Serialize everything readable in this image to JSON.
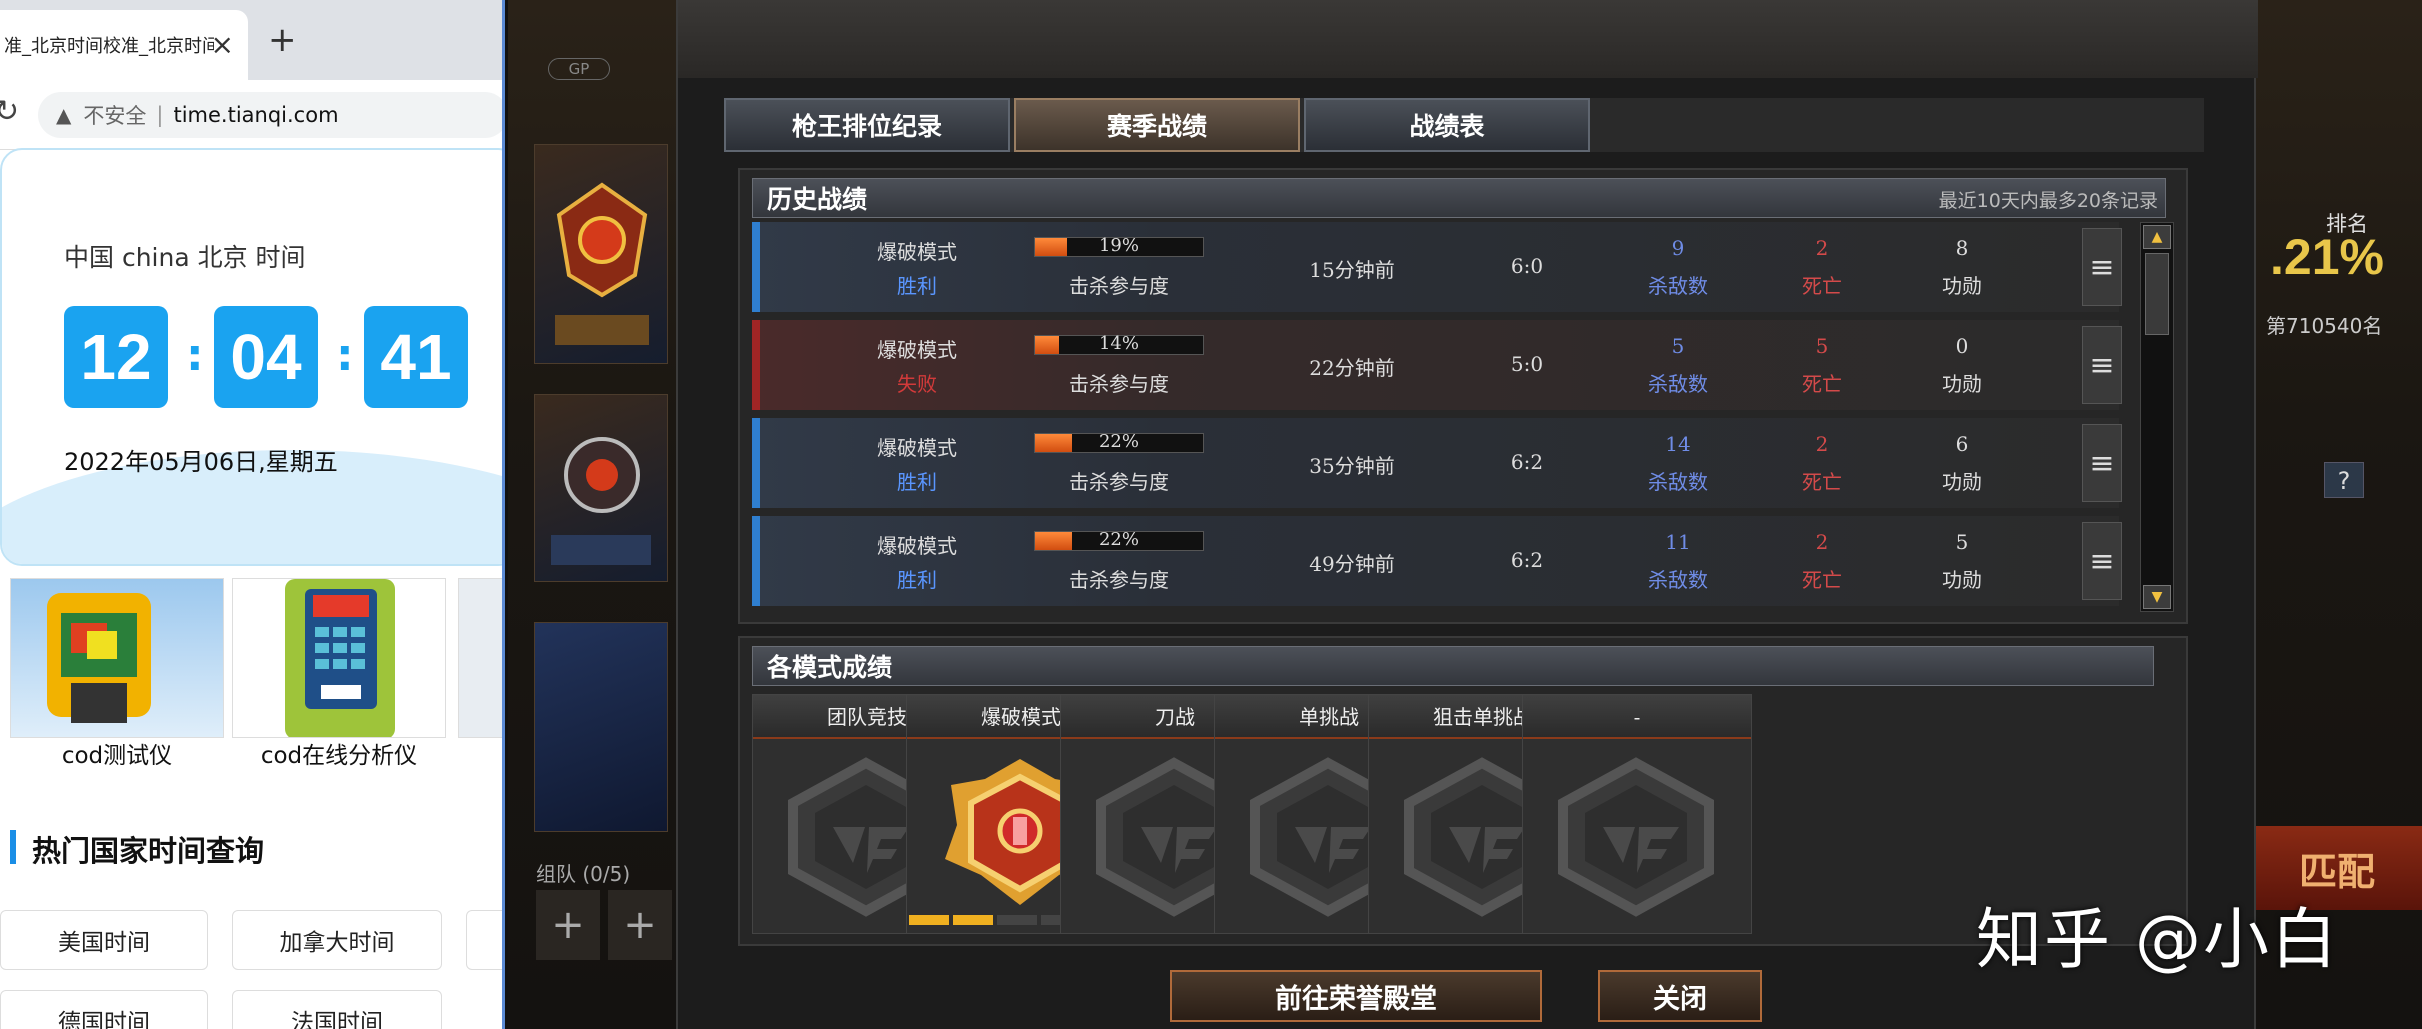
{
  "browser": {
    "tab_title": "准_北京时间校准_北京时间",
    "new_tab": "+",
    "close": "×",
    "security_label": "不安全",
    "separator": "|",
    "url": "time.tianqi.com",
    "clock": {
      "title": "中国 china 北京 时间",
      "hours": "12",
      "minutes": "04",
      "seconds": "41",
      "colon": ":",
      "date": "2022年05月06日,星期五"
    },
    "products": [
      {
        "label": "cod测试仪"
      },
      {
        "label": "cod在线分析仪"
      }
    ],
    "hot_title": "热门国家时间查询",
    "countries": [
      "美国时间",
      "加拿大时间",
      "德国时间",
      "法国时间"
    ]
  },
  "game": {
    "gp_label": "GP",
    "team_label": "组队 (0/5)",
    "plus": "+",
    "rank_label": "排名",
    "rank_pct": ".21%",
    "rank_number": "第710540名",
    "help": "?",
    "match_button": "匹配",
    "watermark": "知乎 @小白"
  },
  "dialog": {
    "tabs": [
      "枪王排位纪录",
      "赛季战绩",
      "战绩表"
    ],
    "active_tab": 1,
    "history": {
      "title": "历史战绩",
      "note": "最近10天内最多20条记录",
      "rows": [
        {
          "mode": "爆破模式",
          "result": "胜利",
          "outcome": "win",
          "pct": 19,
          "pct_text": "19%",
          "part_label": "击杀参与度",
          "ago": "15分钟前",
          "score": "6:0",
          "kills": "9",
          "kills_label": "杀敌数",
          "deaths": "2",
          "deaths_label": "死亡",
          "merit": "8",
          "merit_label": "功勋"
        },
        {
          "mode": "爆破模式",
          "result": "失败",
          "outcome": "loss",
          "pct": 14,
          "pct_text": "14%",
          "part_label": "击杀参与度",
          "ago": "22分钟前",
          "score": "5:0",
          "kills": "5",
          "kills_label": "杀敌数",
          "deaths": "5",
          "deaths_label": "死亡",
          "merit": "0",
          "merit_label": "功勋"
        },
        {
          "mode": "爆破模式",
          "result": "胜利",
          "outcome": "win",
          "pct": 22,
          "pct_text": "22%",
          "part_label": "击杀参与度",
          "ago": "35分钟前",
          "score": "6:2",
          "kills": "14",
          "kills_label": "杀敌数",
          "deaths": "2",
          "deaths_label": "死亡",
          "merit": "6",
          "merit_label": "功勋"
        },
        {
          "mode": "爆破模式",
          "result": "胜利",
          "outcome": "win",
          "pct": 22,
          "pct_text": "22%",
          "part_label": "击杀参与度",
          "ago": "49分钟前",
          "score": "6:2",
          "kills": "11",
          "kills_label": "杀敌数",
          "deaths": "2",
          "deaths_label": "死亡",
          "merit": "5",
          "merit_label": "功勋"
        }
      ]
    },
    "modes": {
      "title": "各模式成绩",
      "cards": [
        {
          "name": "团队竞技",
          "ranked": false
        },
        {
          "name": "爆破模式",
          "ranked": true,
          "progress_segments": 5,
          "progress_filled": 2
        },
        {
          "name": "刀战",
          "ranked": false
        },
        {
          "name": "单挑战",
          "ranked": false
        },
        {
          "name": "狙击单挑战",
          "ranked": false
        },
        {
          "name": "-",
          "ranked": false
        }
      ]
    },
    "buttons": {
      "hall": "前往荣誉殿堂",
      "close": "关闭"
    }
  }
}
